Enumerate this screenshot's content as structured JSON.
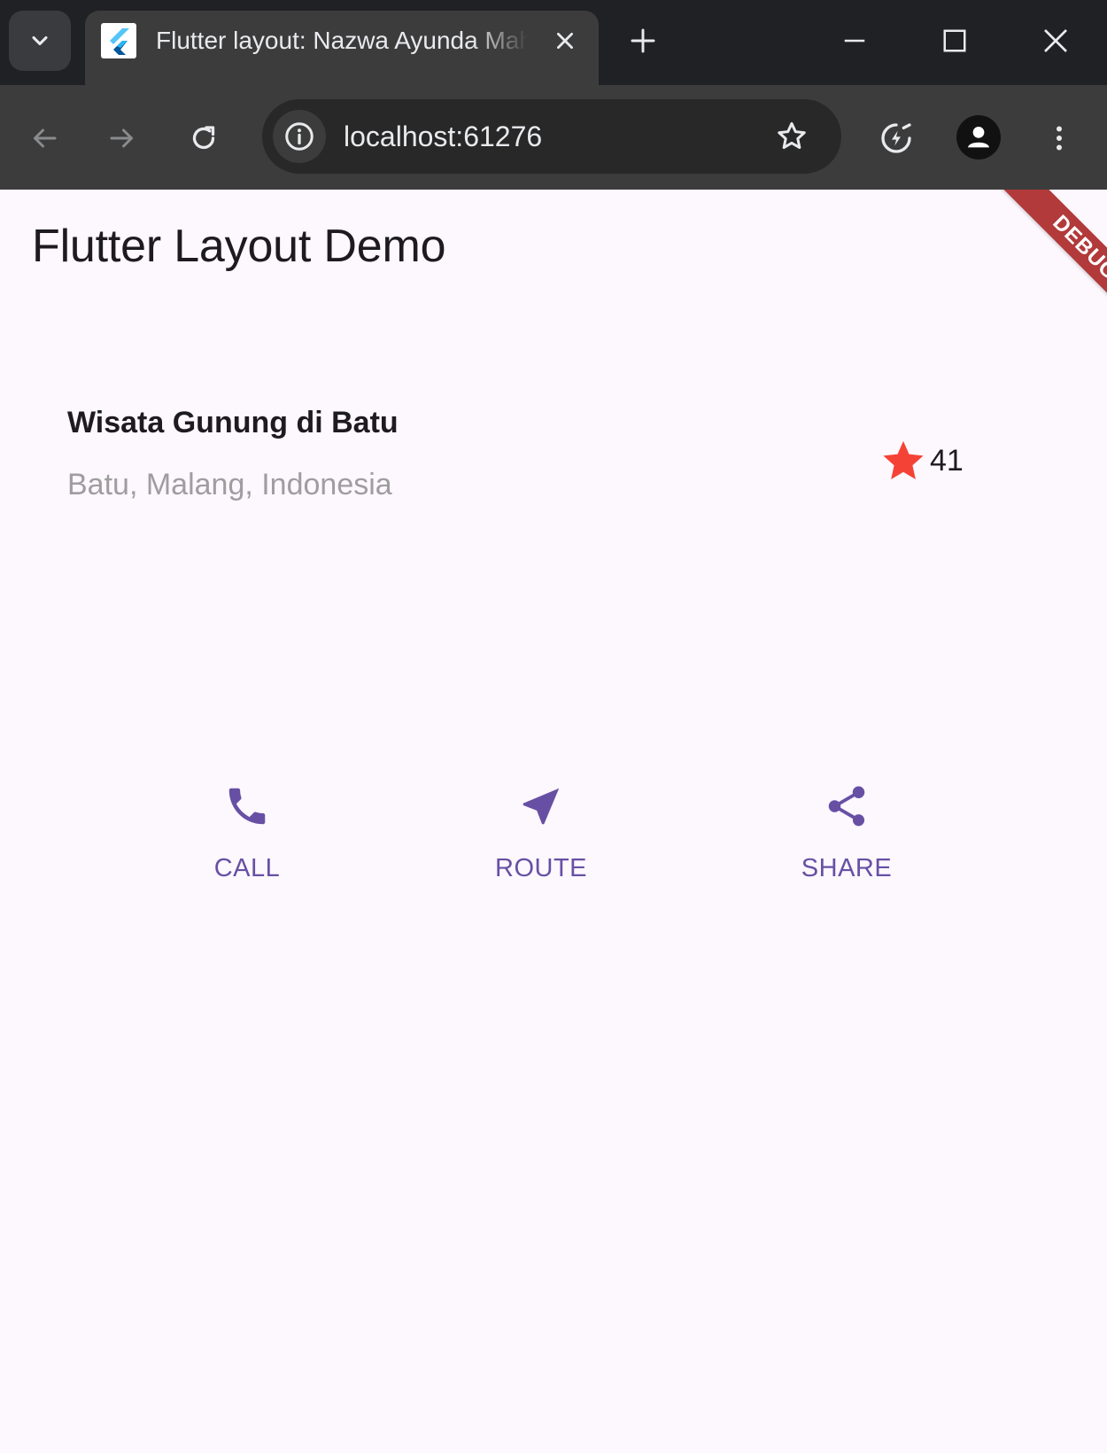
{
  "browser": {
    "tab_title": "Flutter layout: Nazwa Ayunda Mahardika",
    "url": "localhost:61276"
  },
  "app": {
    "title": "Flutter Layout Demo",
    "debug_banner": "DEBUG",
    "place": {
      "name": "Wisata Gunung di Batu",
      "location": "Batu, Malang, Indonesia",
      "rating_count": "41"
    },
    "actions": [
      {
        "label": "CALL",
        "icon": "phone-icon"
      },
      {
        "label": "ROUTE",
        "icon": "near-me-icon"
      },
      {
        "label": "SHARE",
        "icon": "share-icon"
      }
    ],
    "colors": {
      "accent": "#6750a4",
      "star": "#f44336",
      "background": "#fdf7fe"
    }
  }
}
